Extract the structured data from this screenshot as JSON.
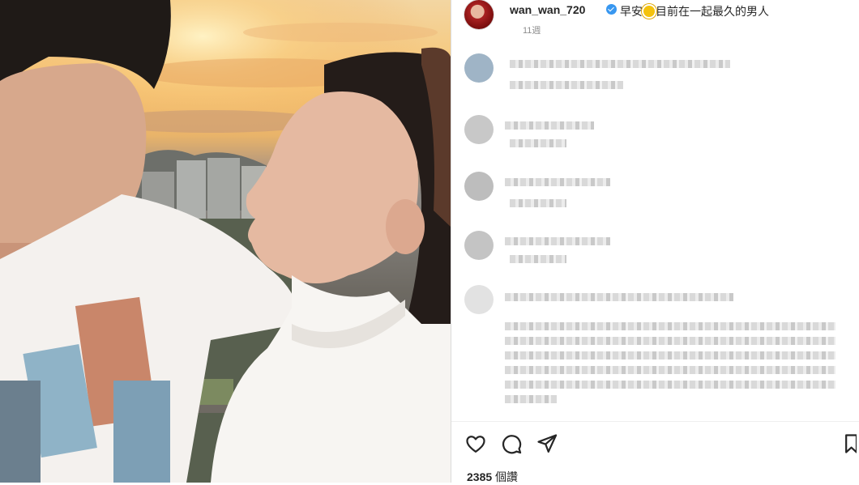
{
  "post": {
    "username": "wan_wan_720",
    "caption": "目前在一起最久的男人",
    "caption_prefix": "早安",
    "time_ago": "11週",
    "view_count": "2385",
    "view_unit": "個讚"
  },
  "icons": {
    "like": "heart-icon",
    "comment": "comment-icon",
    "share": "share-icon",
    "save": "bookmark-icon"
  },
  "colors": {
    "verified": "#3897f0",
    "text": "#262626",
    "muted": "#8e8e8e"
  }
}
